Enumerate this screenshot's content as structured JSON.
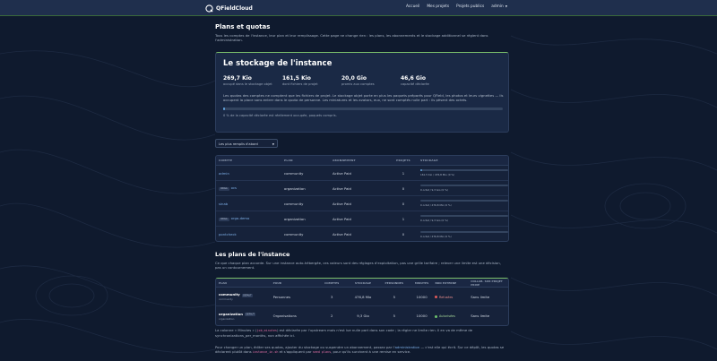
{
  "nav": {
    "brand": "QFieldCloud",
    "links": [
      "Accueil",
      "Mes projets",
      "Projets publics"
    ],
    "user": "admin"
  },
  "page": {
    "title": "Plans et quotas",
    "intro": "Tous les comptes de l'instance, leur plan et leur remplissage. Cette page ne change rien : les plans, les abonnements et le stockage additionnel se règlent dans l'administration."
  },
  "storage": {
    "title": "Le stockage de l'instance",
    "stats": [
      {
        "value": "269,7 Kio",
        "label": "occupé dans le stockage objet"
      },
      {
        "value": "161,5 Kio",
        "label": "dont fichiers de projet"
      },
      {
        "value": "20,0 Gio",
        "label": "promis aux comptes"
      },
      {
        "value": "46,6 Gio",
        "label": "capacité déclarée"
      }
    ],
    "description": "Les quotas des comptes ne comptent que les fichiers de projet. Le stockage objet porte en plus les paquets préparés pour QField, les photos et leurs vignettes — ils occupent la place sans entrer dans le quota de personne. Les miniatures et les avatars, eux, ne sont comptés nulle part : ils pèsent des octets.",
    "usage_fraction": 0.005,
    "note": "0 % de la capacité déclarée est réellement occupée, paquets compris."
  },
  "sort": {
    "selected": "Les plus remplis d'abord"
  },
  "accounts": {
    "headers": [
      "COMPTE",
      "PLAN",
      "ABONNEMENT",
      "PROJETS",
      "STOCKAGE"
    ],
    "rows": [
      {
        "tag": "",
        "name": "admin",
        "plan": "community",
        "abo": "Active Paid",
        "projects": "1",
        "usage": 0.02,
        "storage": "161,5 Kio / 476,8 Mio (0 %)"
      },
      {
        "tag": "ORGA",
        "name": "ocs",
        "plan": "organization",
        "abo": "Active Paid",
        "projects": "0",
        "usage": 0,
        "storage": "0 octet / 9,3 Gio (0 %)"
      },
      {
        "tag": "",
        "name": "sinab",
        "plan": "community",
        "abo": "Active Paid",
        "projects": "0",
        "usage": 0,
        "storage": "0 octet / 476,8 Mio (0 %)"
      },
      {
        "tag": "ORGA",
        "name": "orga-demo",
        "plan": "organization",
        "abo": "Active Paid",
        "projects": "1",
        "usage": 0,
        "storage": "0 octet / 9,3 Gio (0 %)"
      },
      {
        "tag": "",
        "name": "pontcheck",
        "plan": "community",
        "abo": "Active Paid",
        "projects": "0",
        "usage": 0,
        "storage": "0 octet / 476,8 Mio (0 %)"
      }
    ]
  },
  "plans": {
    "title": "Les plans de l'instance",
    "intro": "Ce que chaque plan accorde. Sur une instance auto-hébergée, ces valeurs sont des réglages d'exploitation, pas une grille tarifaire ; relever une limite est une décision, pas un contournement.",
    "headers": [
      "PLAN",
      "POUR",
      "COMPTES",
      "STOCKAGE",
      "PERSONNES",
      "MINUTES",
      "BDD EXTERNE",
      "COLLAB. SUR PROJET PRIVÉ"
    ],
    "rows": [
      {
        "name": "community",
        "badge": "DÉFAUT",
        "code": "community",
        "pour": "Personnes",
        "comptes": "3",
        "stockage": "476,8 Mio",
        "personnes": "5",
        "minutes": "10000",
        "ext": "Refusées",
        "ext_ok": false,
        "collab": "Sans limite"
      },
      {
        "name": "organization",
        "badge": "DÉFAUT",
        "code": "organization",
        "pour": "Organisations",
        "comptes": "2",
        "stockage": "9,3 Gio",
        "personnes": "5",
        "minutes": "10000",
        "ext": "Autorisées",
        "ext_ok": true,
        "collab": "Sans limite"
      }
    ]
  },
  "notes": {
    "n1_a": "La colonne « Minutes » (",
    "n1_code": "job_minutes",
    "n1_b": ") est déclarée par l'upstream mais n'est lue nulle part dans son code ; la régler ne limite rien. Il en va de même de synchronizations_per_months, non affichée ici.",
    "n2_a": "Pour changer un plan, éditer ses quotas, ajouter du stockage ou suspendre un abonnement, passez par l'",
    "n2_link": "administration",
    "n2_b": " — c'est elle qui écrit. Sur ce dépôt, les quotas se déclarent plutôt dans ",
    "n2_code1": "instance_in.sh",
    "n2_c": " et s'appliquent par ",
    "n2_code2": "seed plans",
    "n2_d": ", pour qu'ils survivent à une remise en service."
  }
}
